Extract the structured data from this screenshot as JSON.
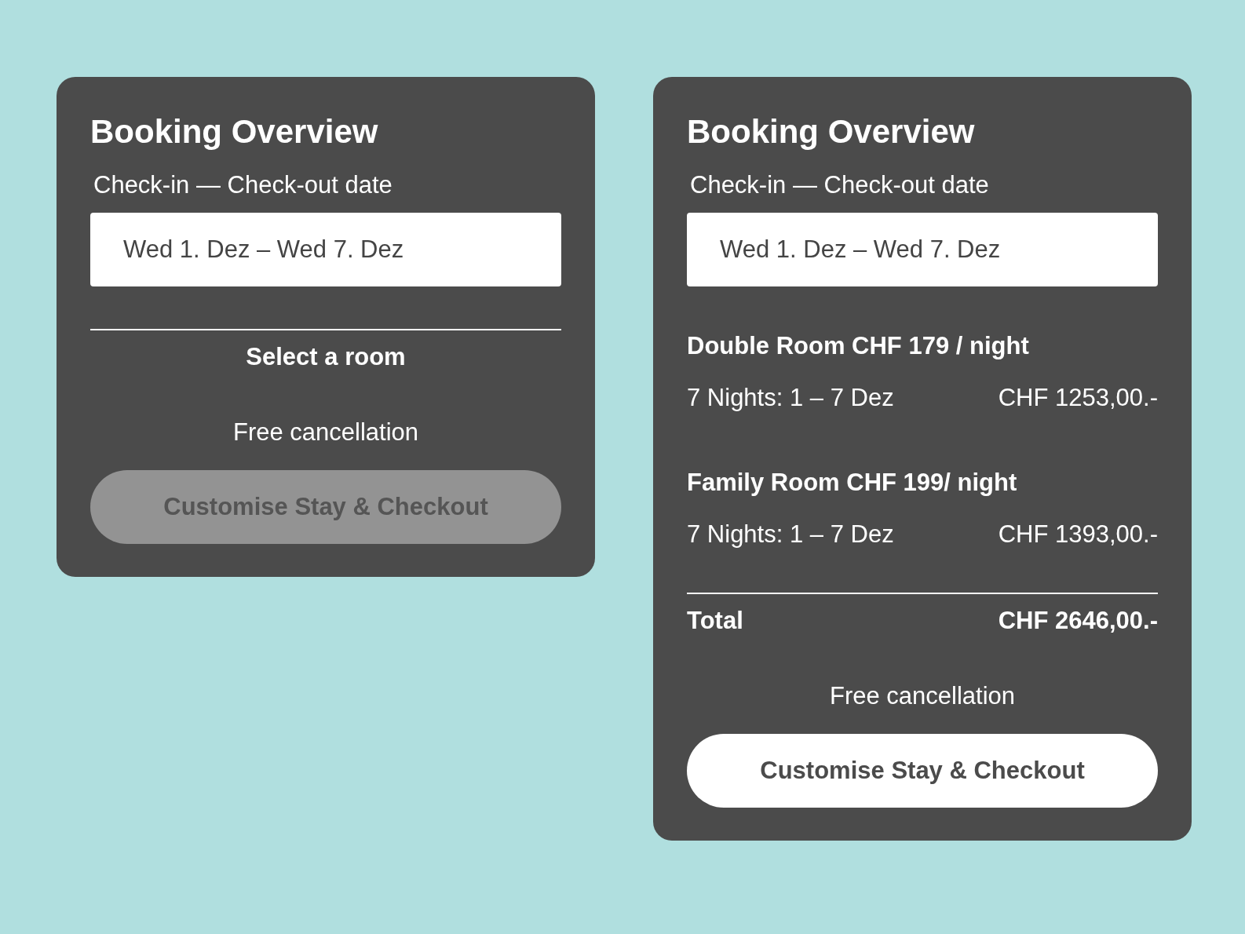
{
  "cards": [
    {
      "title": "Booking Overview",
      "date_label": "Check-in — Check-out date",
      "date_value": "Wed 1. Dez – Wed 7. Dez",
      "prompt": "Select a room",
      "note": "Free cancellation",
      "button": {
        "label": "Customise Stay & Checkout",
        "disabled": true
      }
    },
    {
      "title": "Booking Overview",
      "date_label": "Check-in — Check-out date",
      "date_value": "Wed 1. Dez – Wed 7. Dez",
      "rooms": [
        {
          "name": "Double Room CHF 179 / night",
          "nights": "7 Nights: 1 – 7 Dez",
          "price": "CHF 1253,00.-"
        },
        {
          "name": "Family Room CHF 199/ night",
          "nights": "7 Nights: 1 – 7 Dez",
          "price": "CHF 1393,00.-"
        }
      ],
      "total": {
        "label": "Total",
        "value": "CHF 2646,00.-"
      },
      "note": "Free cancellation",
      "button": {
        "label": "Customise Stay & Checkout",
        "disabled": false
      }
    }
  ]
}
